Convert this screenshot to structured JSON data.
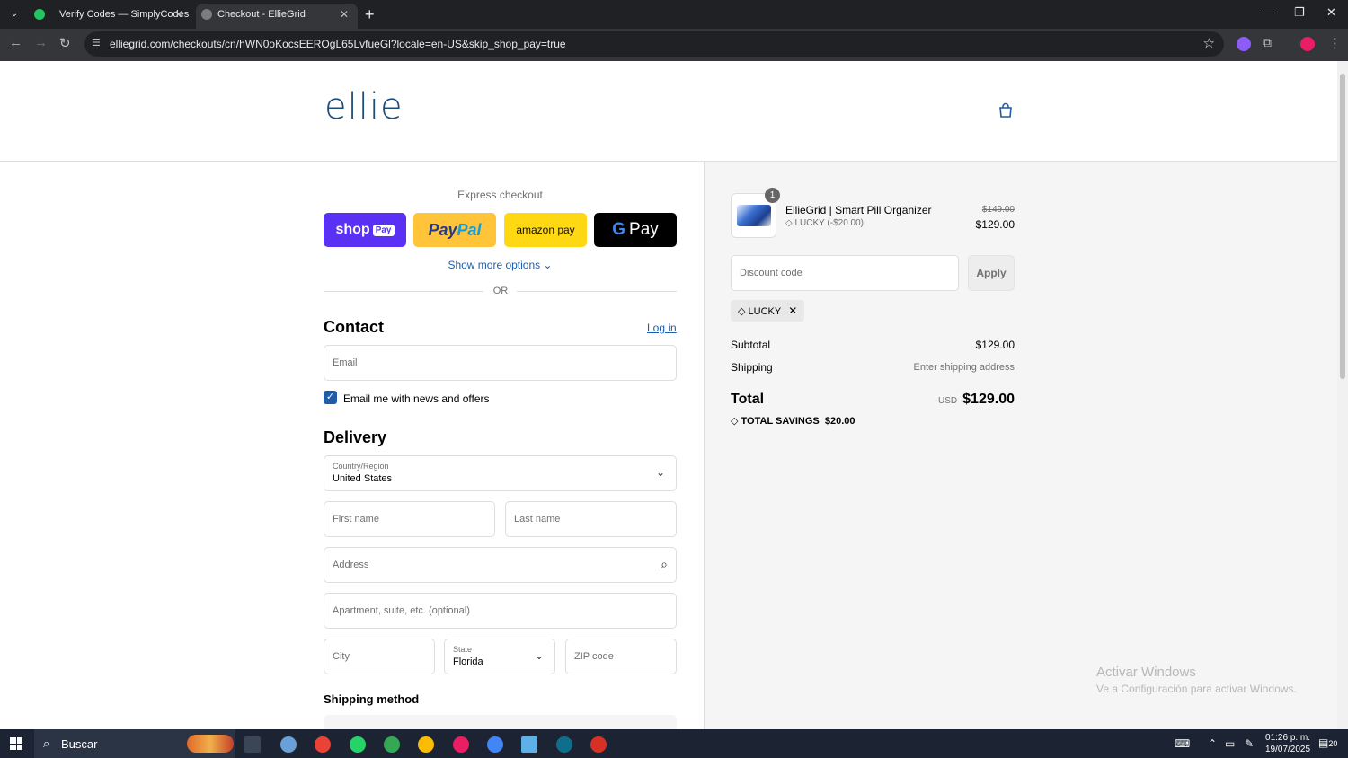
{
  "browser": {
    "tabs": [
      {
        "label": "Verify Codes — SimplyCodes"
      },
      {
        "label": "Checkout - EllieGrid"
      }
    ],
    "url": "elliegrid.com/checkouts/cn/hWN0oKocsEEROgL65LvfueGl?locale=en-US&skip_shop_pay=true"
  },
  "header": {
    "logo": "ellie"
  },
  "express": {
    "title": "Express checkout",
    "shop": "shop",
    "shop_pay": "Pay",
    "paypal_a": "Pay",
    "paypal_b": "Pal",
    "amazon": "amazon pay",
    "gpay_g": "G",
    "gpay": "Pay",
    "more": "Show more options ⌄",
    "or": "OR"
  },
  "contact": {
    "title": "Contact",
    "login": "Log in",
    "email_placeholder": "Email",
    "newsletter": "Email me with news and offers"
  },
  "delivery": {
    "title": "Delivery",
    "country_label": "Country/Region",
    "country_value": "United States",
    "first_name": "First name",
    "last_name": "Last name",
    "address": "Address",
    "apartment": "Apartment, suite, etc. (optional)",
    "city": "City",
    "state_label": "State",
    "state_value": "Florida",
    "zip": "ZIP code",
    "shipping_method": "Shipping method"
  },
  "order": {
    "qty": "1",
    "product": "EllieGrid | Smart Pill Organizer",
    "discount_line": "LUCKY (-$20.00)",
    "old_price": "$149.00",
    "new_price": "$129.00",
    "discount_placeholder": "Discount code",
    "apply": "Apply",
    "tag": "LUCKY",
    "subtotal_label": "Subtotal",
    "subtotal_value": "$129.00",
    "shipping_label": "Shipping",
    "shipping_value": "Enter shipping address",
    "total_label": "Total",
    "currency": "USD",
    "total_value": "$129.00",
    "savings_label": "TOTAL SAVINGS",
    "savings_value": "$20.00"
  },
  "watermark": {
    "line1": "Activar Windows",
    "line2": "Ve a Configuración para activar Windows."
  },
  "taskbar": {
    "search": "Buscar",
    "time": "01:26 p. m.",
    "date": "19/07/2025",
    "notif": "20"
  }
}
